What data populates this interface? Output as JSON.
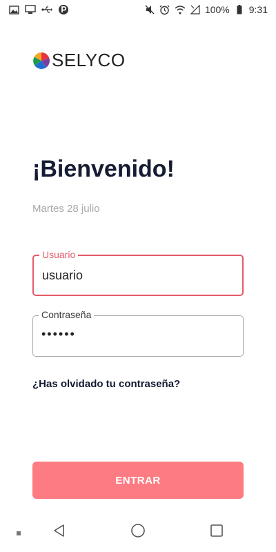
{
  "status_bar": {
    "battery": "100%",
    "time": "9:31",
    "icons_left": [
      "image-icon",
      "monitor-icon",
      "usb-icon",
      "p-icon"
    ],
    "icons_right": [
      "mute-icon",
      "alarm-icon",
      "wifi-icon",
      "signal-icon"
    ]
  },
  "brand": {
    "name": "SELYCO",
    "colors": [
      "#e5353b",
      "#f6a623",
      "#1c9d4c",
      "#1f6fd1",
      "#7a3fa0"
    ]
  },
  "login": {
    "title": "¡Bienvenido!",
    "date": "Martes 28 julio",
    "username": {
      "label": "Usuario",
      "value": "usuario"
    },
    "password": {
      "label": "Contraseña",
      "value": "••••••"
    },
    "forgot_link": "¿Has olvidado tu contraseña?",
    "submit_label": "ENTRAR"
  },
  "colors": {
    "accent": "#e35b68",
    "button": "#fd7b82",
    "heading": "#161c34"
  }
}
